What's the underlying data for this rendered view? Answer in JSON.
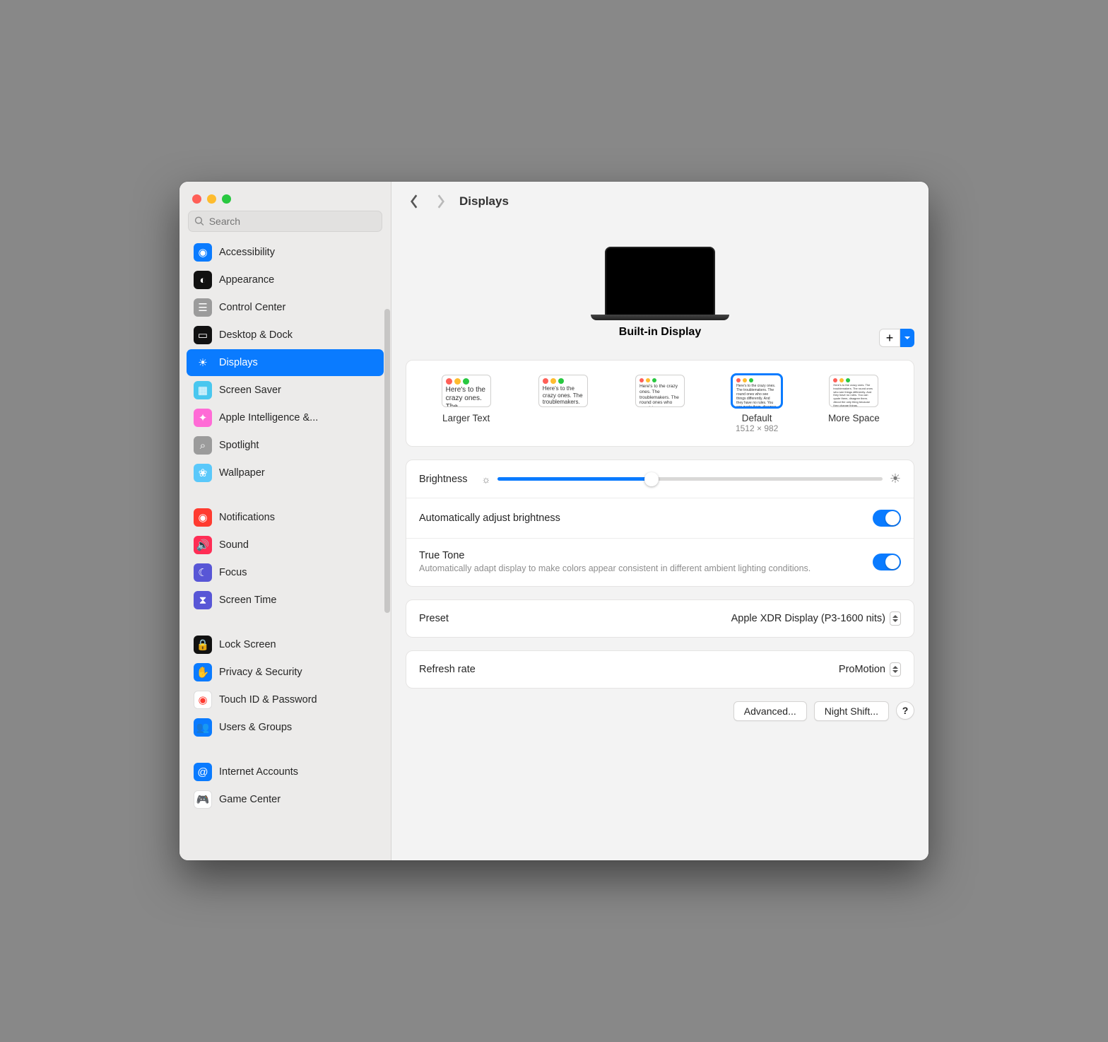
{
  "search": {
    "placeholder": "Search"
  },
  "sidebar": {
    "items": [
      {
        "label": "Accessibility",
        "icon_bg": "#0a7bff",
        "glyph": "person-arms-icon"
      },
      {
        "label": "Appearance",
        "icon_bg": "#111",
        "glyph": "half-circle-icon"
      },
      {
        "label": "Control Center",
        "icon_bg": "#9b9b9b",
        "glyph": "sliders-icon"
      },
      {
        "label": "Desktop & Dock",
        "icon_bg": "#111",
        "glyph": "window-icon"
      },
      {
        "label": "Displays",
        "icon_bg": "#0a7bff",
        "glyph": "sun-icon",
        "active": true
      },
      {
        "label": "Screen Saver",
        "icon_bg": "#49c7ef",
        "glyph": "photo-icon"
      },
      {
        "label": "Apple Intelligence &...",
        "icon_bg": "#ff6bd6",
        "glyph": "sparkle-icon"
      },
      {
        "label": "Spotlight",
        "icon_bg": "#9b9b9b",
        "glyph": "magnifier-icon"
      },
      {
        "label": "Wallpaper",
        "icon_bg": "#5ac8fa",
        "glyph": "flower-icon"
      },
      {
        "gap": true
      },
      {
        "label": "Notifications",
        "icon_bg": "#ff3b30",
        "glyph": "bell-icon"
      },
      {
        "label": "Sound",
        "icon_bg": "#ff2d55",
        "glyph": "speaker-icon"
      },
      {
        "label": "Focus",
        "icon_bg": "#5856d6",
        "glyph": "moon-icon"
      },
      {
        "label": "Screen Time",
        "icon_bg": "#5856d6",
        "glyph": "hourglass-icon"
      },
      {
        "gap": true
      },
      {
        "label": "Lock Screen",
        "icon_bg": "#111",
        "glyph": "lock-icon"
      },
      {
        "label": "Privacy & Security",
        "icon_bg": "#0a7bff",
        "glyph": "hand-icon"
      },
      {
        "label": "Touch ID & Password",
        "icon_bg": "#fff",
        "glyph": "fingerprint-icon"
      },
      {
        "label": "Users & Groups",
        "icon_bg": "#0a7bff",
        "glyph": "people-icon"
      },
      {
        "gap": true
      },
      {
        "label": "Internet Accounts",
        "icon_bg": "#0a7bff",
        "glyph": "at-icon"
      },
      {
        "label": "Game Center",
        "icon_bg": "#fff",
        "glyph": "gamepad-icon"
      }
    ]
  },
  "header": {
    "title": "Displays"
  },
  "display": {
    "name": "Built-in Display"
  },
  "resolutions": {
    "sample_text": "Here's to the crazy ones. The troublemakers. The round ones who see things differently. And they have no rules. You can quote them, disagree them. About the only thing because they change things.",
    "options": [
      {
        "label": "Larger Text"
      },
      {
        "label": "·"
      },
      {
        "label": "·"
      },
      {
        "label": "Default",
        "sub": "1512 × 982",
        "selected": true
      },
      {
        "label": "More Space"
      }
    ]
  },
  "brightness": {
    "label": "Brightness",
    "value": 40
  },
  "auto_brightness": {
    "label": "Automatically adjust brightness",
    "enabled": true
  },
  "true_tone": {
    "label": "True Tone",
    "desc": "Automatically adapt display to make colors appear consistent in different ambient lighting conditions.",
    "enabled": true
  },
  "preset": {
    "label": "Preset",
    "value": "Apple XDR Display (P3-1600 nits)"
  },
  "refresh": {
    "label": "Refresh rate",
    "value": "ProMotion"
  },
  "buttons": {
    "advanced": "Advanced...",
    "night_shift": "Night Shift...",
    "help": "?"
  }
}
